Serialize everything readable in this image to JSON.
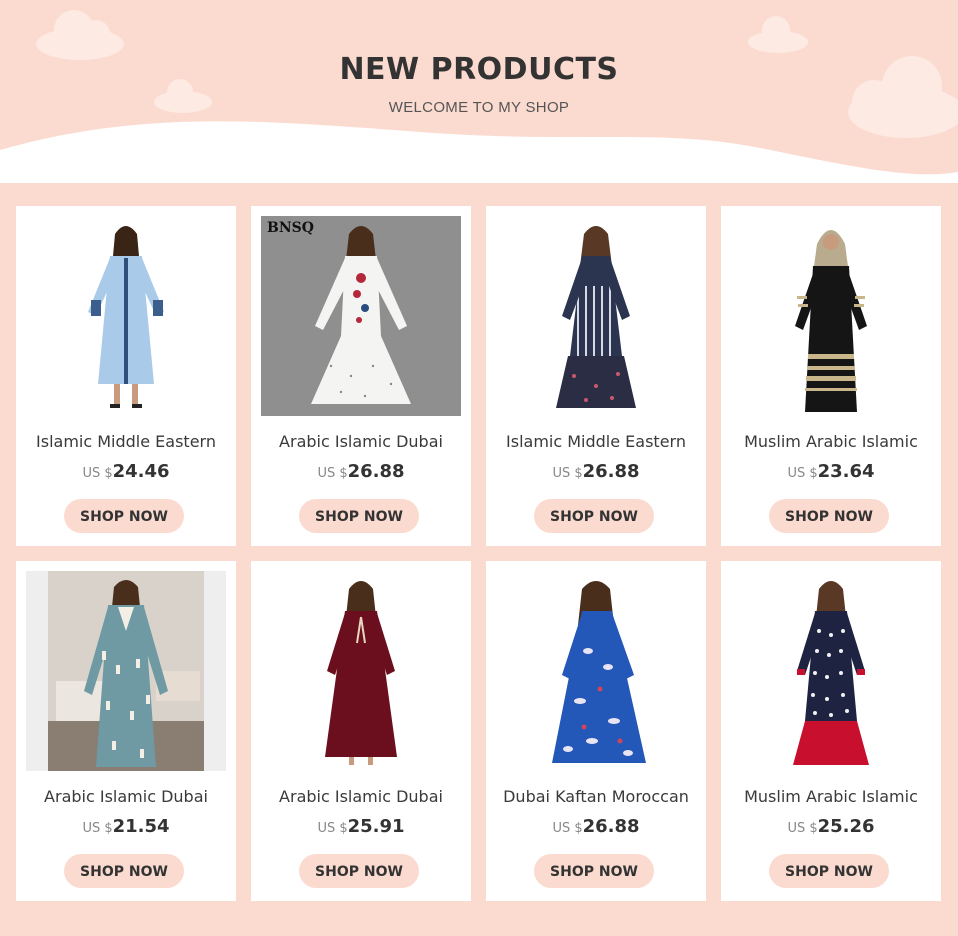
{
  "header": {
    "title": "NEW PRODUCTS",
    "subtitle": "WELCOME TO MY SHOP"
  },
  "colors": {
    "background": "#fbdbd0",
    "card": "#ffffff",
    "button": "#fbdbd0",
    "text": "#333333"
  },
  "products": [
    {
      "name": "Islamic Middle Eastern",
      "currency": "US $",
      "price": "24.46",
      "button": "SHOP NOW",
      "image": "light-blue-embroidered-abaya-photo"
    },
    {
      "name": "Arabic Islamic Dubai",
      "currency": "US $",
      "price": "26.88",
      "button": "SHOP NOW",
      "image": "white-polka-dot-floral-dress-photo",
      "image_text": "BNSQ"
    },
    {
      "name": "Islamic Middle Eastern",
      "currency": "US $",
      "price": "26.88",
      "button": "SHOP NOW",
      "image": "striped-floral-patchwork-maxi-photo"
    },
    {
      "name": "Muslim Arabic Islamic",
      "currency": "US $",
      "price": "23.64",
      "button": "SHOP NOW",
      "image": "black-striped-abaya-hijab-photo"
    },
    {
      "name": "Arabic Islamic Dubai",
      "currency": "US $",
      "price": "21.54",
      "button": "SHOP NOW",
      "image": "teal-tassel-kaftan-mirror-photo"
    },
    {
      "name": "Arabic Islamic Dubai",
      "currency": "US $",
      "price": "25.91",
      "button": "SHOP NOW",
      "image": "burgundy-velvet-maxi-dress-photo"
    },
    {
      "name": "Dubai Kaftan Moroccan",
      "currency": "US $",
      "price": "26.88",
      "button": "SHOP NOW",
      "image": "blue-floral-print-kaftan-photo"
    },
    {
      "name": "Muslim Arabic Islamic",
      "currency": "US $",
      "price": "25.26",
      "button": "SHOP NOW",
      "image": "navy-polka-dot-red-hem-dress-photo"
    }
  ]
}
